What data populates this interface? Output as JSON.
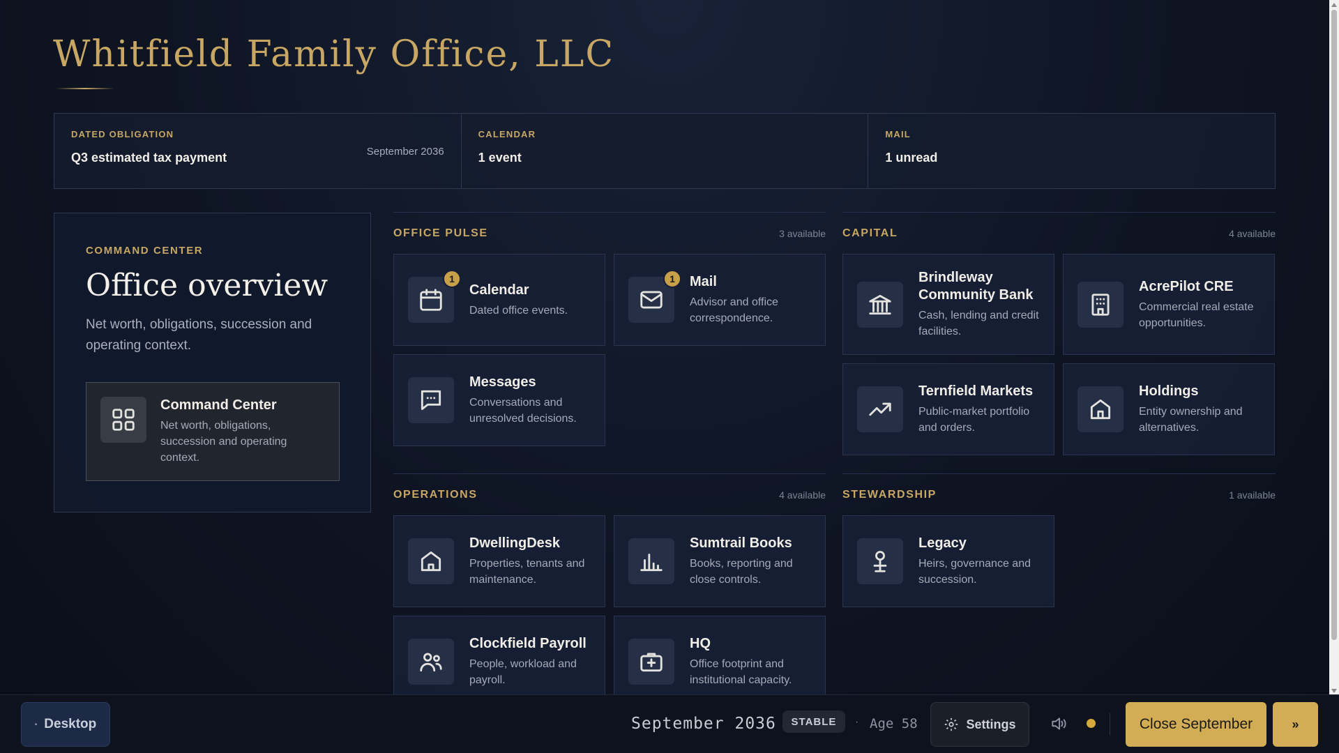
{
  "page_title": "Whitfield Family Office, LLC",
  "strip": {
    "obligation": {
      "label": "DATED OBLIGATION",
      "value": "Q3 estimated tax payment",
      "date": "September 2036"
    },
    "calendar": {
      "label": "CALENDAR",
      "value": "1 event"
    },
    "mail": {
      "label": "MAIL",
      "value": "1 unread"
    }
  },
  "command_center": {
    "eyebrow": "COMMAND CENTER",
    "title": "Office overview",
    "description": "Net worth, obligations, succession and operating context.",
    "card": {
      "name": "Command Center",
      "description": "Net worth, obligations, succession and operating context.",
      "icon": "grid-icon"
    }
  },
  "sections": {
    "office_pulse": {
      "title": "OFFICE PULSE",
      "count": "3 available",
      "tiles": [
        {
          "name": "Calendar",
          "description": "Dated office events.",
          "icon": "calendar-icon",
          "badge": "1"
        },
        {
          "name": "Mail",
          "description": "Advisor and office correspondence.",
          "icon": "mail-icon",
          "badge": "1"
        },
        {
          "name": "Messages",
          "description": "Conversations and unresolved decisions.",
          "icon": "chat-icon"
        }
      ]
    },
    "capital": {
      "title": "CAPITAL",
      "count": "4 available",
      "tiles": [
        {
          "name": "Brindleway Community Bank",
          "description": "Cash, lending and credit facilities.",
          "icon": "bank-icon"
        },
        {
          "name": "AcrePilot CRE",
          "description": "Commercial real estate opportunities.",
          "icon": "building-icon"
        },
        {
          "name": "Ternfield Markets",
          "description": "Public-market portfolio and orders.",
          "icon": "trend-up-icon"
        },
        {
          "name": "Holdings",
          "description": "Entity ownership and alternatives.",
          "icon": "house-icon"
        }
      ]
    },
    "operations": {
      "title": "OPERATIONS",
      "count": "4 available",
      "tiles": [
        {
          "name": "DwellingDesk",
          "description": "Properties, tenants and maintenance.",
          "icon": "home-icon"
        },
        {
          "name": "Sumtrail Books",
          "description": "Books, reporting and close controls.",
          "icon": "bar-chart-icon"
        },
        {
          "name": "Clockfield Payroll",
          "description": "People, workload and payroll.",
          "icon": "people-icon"
        },
        {
          "name": "HQ",
          "description": "Office footprint and institutional capacity.",
          "icon": "briefcase-plus-icon"
        }
      ]
    },
    "stewardship": {
      "title": "STEWARDSHIP",
      "count": "1 available",
      "tiles": [
        {
          "name": "Legacy",
          "description": "Heirs, governance and succession.",
          "icon": "person-pin-icon"
        }
      ]
    }
  },
  "bottom_bar": {
    "desktop_label": "Desktop",
    "date": "September 2036",
    "separator": "·",
    "stability": "STABLE",
    "age": "Age 58",
    "settings_label": "Settings",
    "close_label": "Close September",
    "next_label": "»"
  },
  "colors": {
    "accent": "#c8a764",
    "button": "#d2ad55",
    "background": "#0e1422",
    "panel": "#161f34"
  }
}
